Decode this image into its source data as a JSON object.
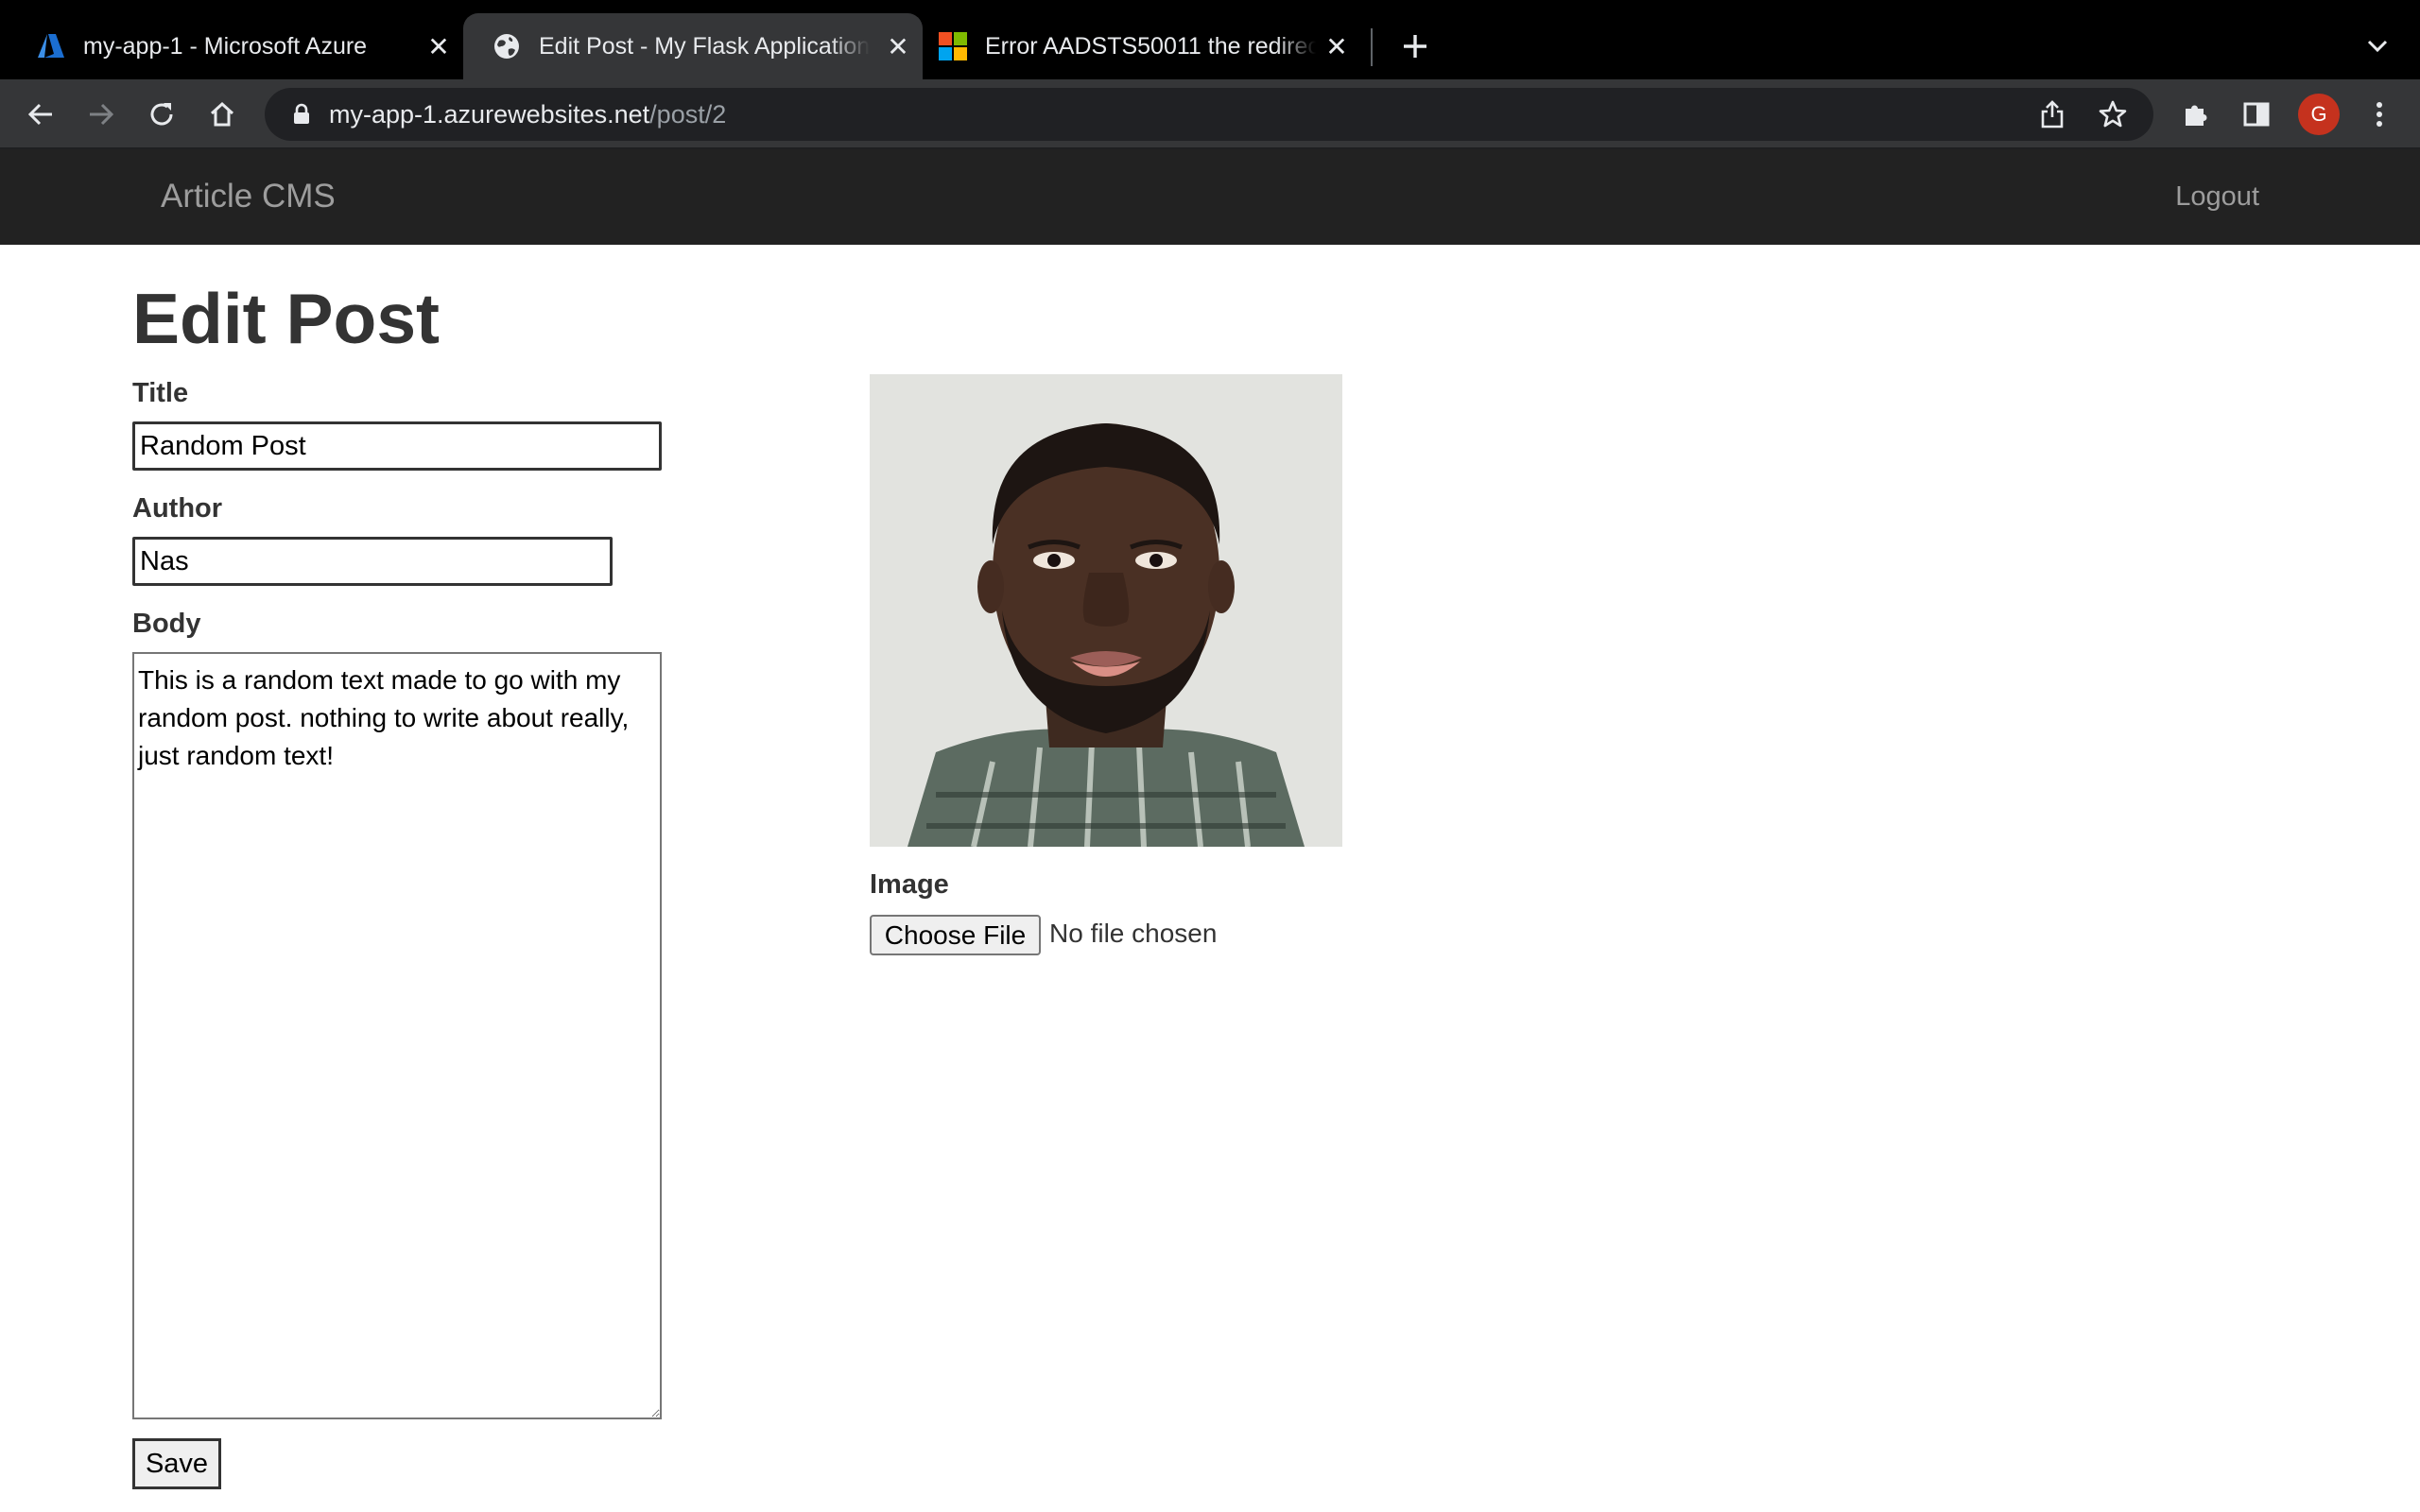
{
  "browser": {
    "tabs": [
      {
        "title": "my-app-1 - Microsoft Azure",
        "icon": "azure-logo-icon",
        "active": false
      },
      {
        "title": "Edit Post - My Flask Application",
        "icon": "globe-icon",
        "active": true
      },
      {
        "title": "Error AADSTS50011 the redirect",
        "icon": "microsoft-logo-icon",
        "active": false
      }
    ],
    "url_host": "my-app-1.azurewebsites.net",
    "url_path": "/post/2",
    "profile_initial": "G",
    "colors": {
      "tabstrip": "#000000",
      "toolbar": "#353638",
      "omnibox": "#202124",
      "avatar": "#c5321e"
    }
  },
  "navbar": {
    "brand": "Article CMS",
    "logout": "Logout",
    "background": "#222222"
  },
  "form": {
    "heading": "Edit Post",
    "title_label": "Title",
    "title_value": "Random Post",
    "author_label": "Author",
    "author_value": "Nas",
    "body_label": "Body",
    "body_value": "This is a random text made to go with my random post. nothing to write about really, just random text!",
    "image_label": "Image",
    "choose_file_label": "Choose File",
    "no_file_text": "No file chosen",
    "save_label": "Save"
  }
}
